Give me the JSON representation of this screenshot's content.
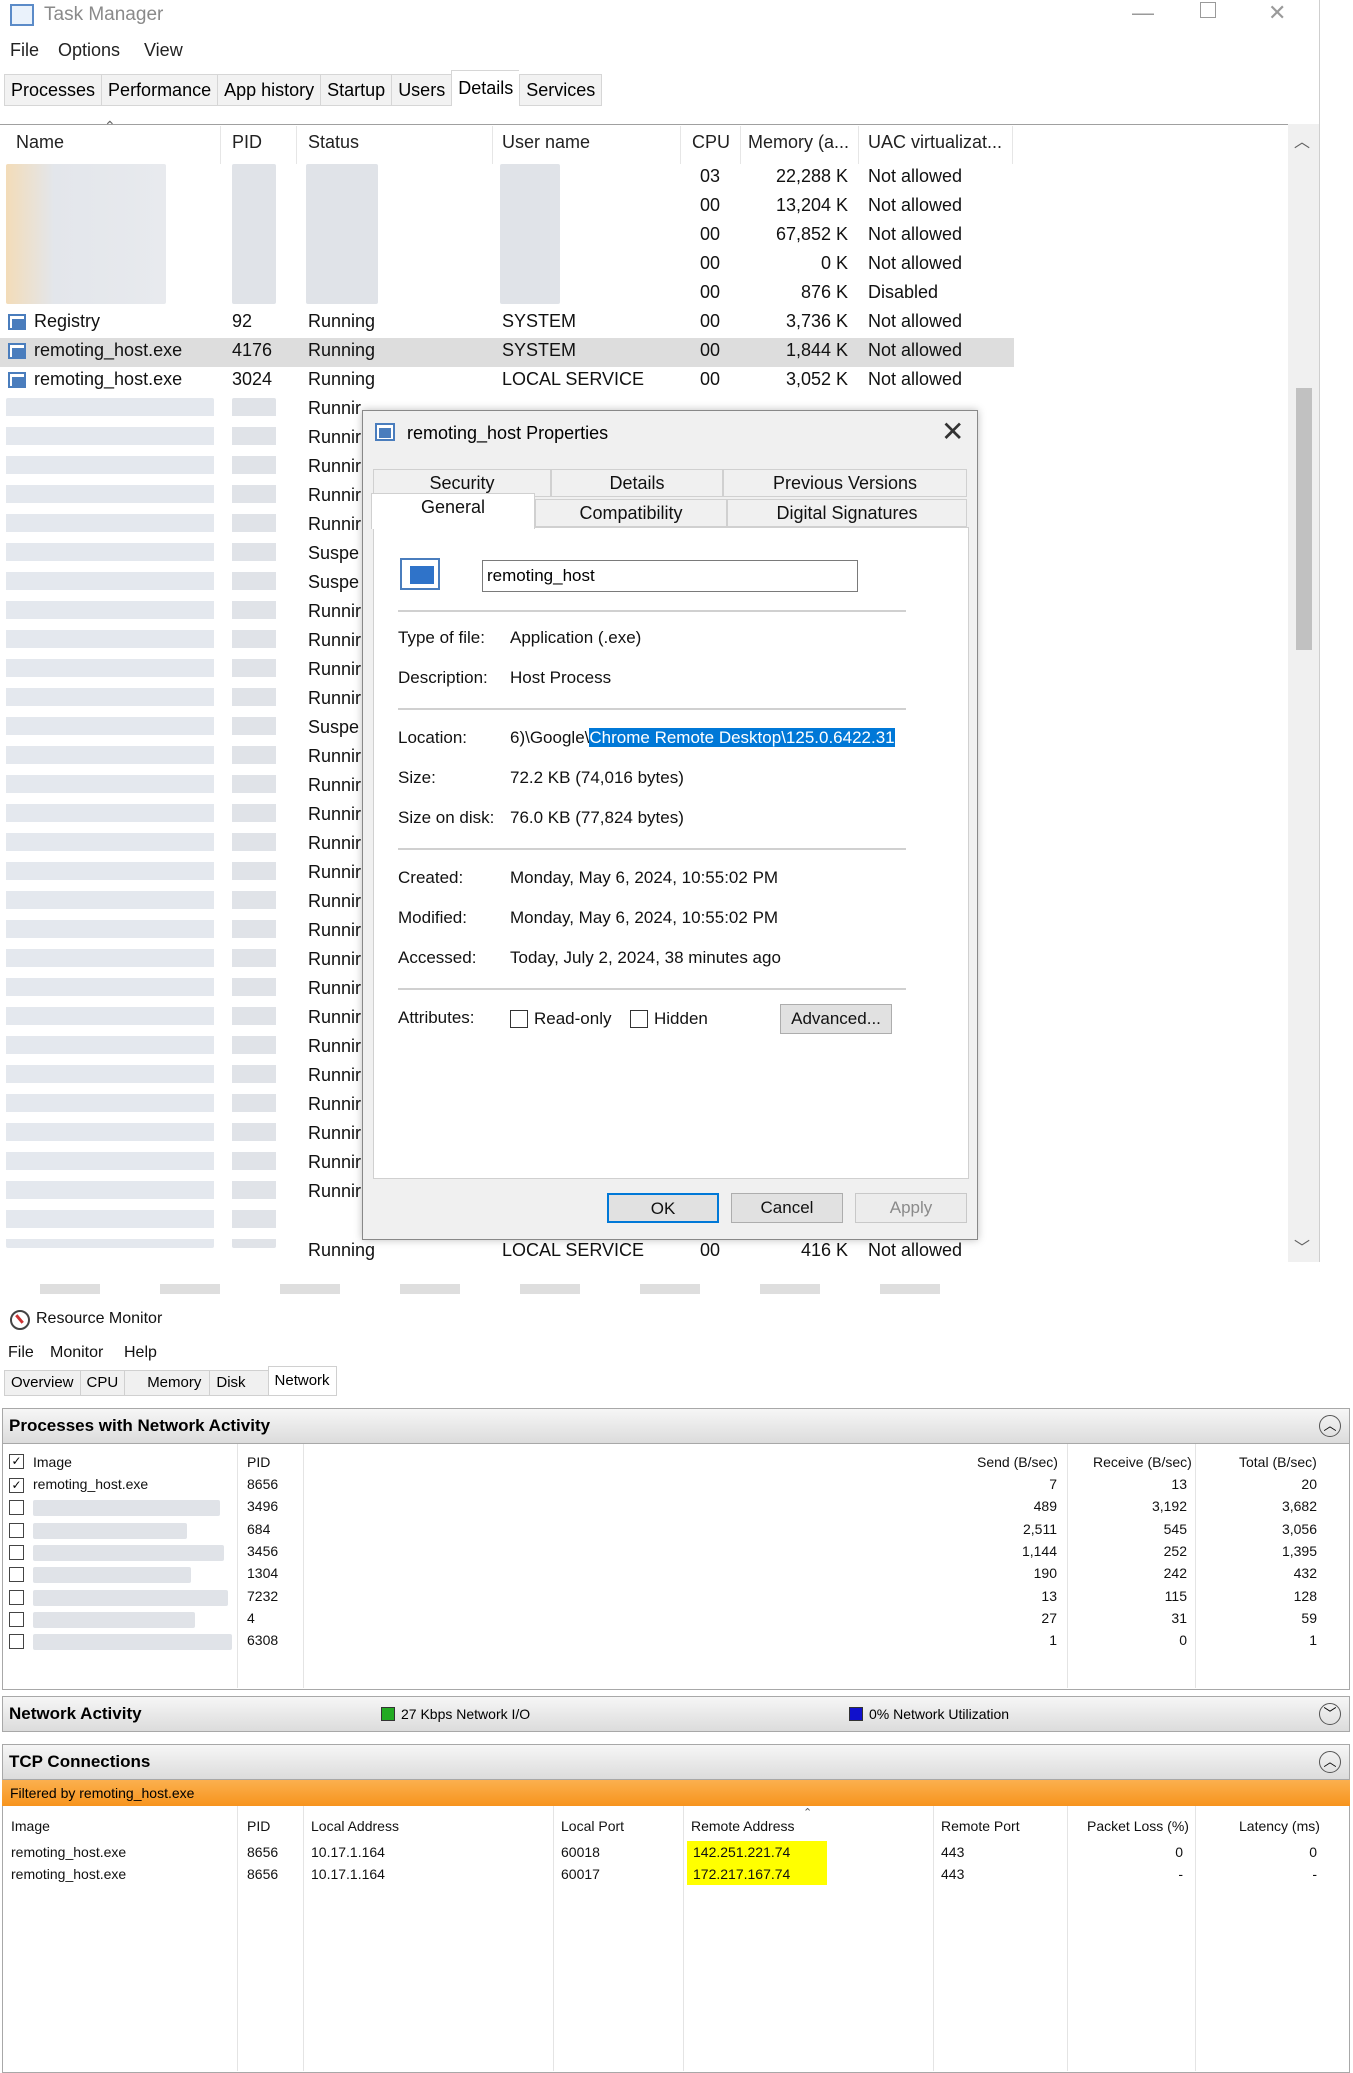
{
  "task_manager": {
    "title": "Task Manager",
    "menu": [
      "File",
      "Options",
      "View"
    ],
    "tabs": [
      "Processes",
      "Performance",
      "App history",
      "Startup",
      "Users",
      "Details",
      "Services"
    ],
    "selected_tab": "Details",
    "columns": [
      "Name",
      "PID",
      "Status",
      "User name",
      "CPU",
      "Memory (a...",
      "UAC virtualizat..."
    ],
    "blurred_rows": [
      {
        "cpu": "03",
        "memory": "22,288 K",
        "uac": "Not allowed"
      },
      {
        "cpu": "00",
        "memory": "13,204 K",
        "uac": "Not allowed"
      },
      {
        "cpu": "00",
        "memory": "67,852 K",
        "uac": "Not allowed"
      },
      {
        "cpu": "00",
        "memory": "0 K",
        "uac": "Not allowed"
      },
      {
        "cpu": "00",
        "memory": "876 K",
        "uac": "Disabled"
      }
    ],
    "rows": [
      {
        "name": "Registry",
        "pid": "92",
        "status": "Running",
        "user": "SYSTEM",
        "cpu": "00",
        "memory": "3,736 K",
        "uac": "Not allowed"
      },
      {
        "name": "remoting_host.exe",
        "pid": "4176",
        "status": "Running",
        "user": "SYSTEM",
        "cpu": "00",
        "memory": "1,844 K",
        "uac": "Not allowed"
      },
      {
        "name": "remoting_host.exe",
        "pid": "3024",
        "status": "Running",
        "user": "LOCAL SERVICE",
        "cpu": "00",
        "memory": "3,052 K",
        "uac": "Not allowed"
      }
    ],
    "partial_statuses": [
      "Runnir",
      "Runnir",
      "Runnir",
      "Runnir",
      "Runnir",
      "Suspe",
      "Suspe",
      "Runnir",
      "Runnir",
      "Runnir",
      "Runnir",
      "Suspe",
      "Runnir",
      "Runnir",
      "Runnir",
      "Runnir",
      "Runnir",
      "Runnir",
      "Runnir",
      "Runnir",
      "Runnir",
      "Runnir",
      "Runnir",
      "Runnir",
      "Runnir",
      "Runnir",
      "Runnir",
      "Runnir"
    ],
    "bottom_row": {
      "status": "Running",
      "user": "LOCAL SERVICE",
      "cpu": "00",
      "memory": "416 K",
      "uac": "Not allowed"
    }
  },
  "properties_dialog": {
    "title": "remoting_host Properties",
    "tabs_top": [
      "Security",
      "Details",
      "Previous Versions"
    ],
    "tabs_bottom": [
      "General",
      "Compatibility",
      "Digital Signatures"
    ],
    "selected_tab": "General",
    "file_name": "remoting_host",
    "type_label": "Type of file:",
    "type_value": "Application (.exe)",
    "desc_label": "Description:",
    "desc_value": "Host Process",
    "location_label": "Location:",
    "location_prefix": "6)\\Google\\",
    "location_highlight": "Chrome Remote Desktop\\125.0.6422.31",
    "size_label": "Size:",
    "size_value": "72.2 KB (74,016 bytes)",
    "size_disk_label": "Size on disk:",
    "size_disk_value": "76.0 KB (77,824 bytes)",
    "created_label": "Created:",
    "created_value": "Monday, May 6, 2024, 10:55:02 PM",
    "modified_label": "Modified:",
    "modified_value": "Monday, May 6, 2024, 10:55:02 PM",
    "accessed_label": "Accessed:",
    "accessed_value": "Today, July 2, 2024, 38 minutes ago",
    "attributes_label": "Attributes:",
    "readonly_label": "Read-only",
    "hidden_label": "Hidden",
    "advanced_label": "Advanced...",
    "ok_label": "OK",
    "cancel_label": "Cancel",
    "apply_label": "Apply"
  },
  "resource_monitor": {
    "title": "Resource Monitor",
    "menu": [
      "File",
      "Monitor",
      "Help"
    ],
    "tabs": [
      "Overview",
      "CPU",
      "Memory",
      "Disk",
      "Network"
    ],
    "selected_tab": "Network",
    "processes_section": "Processes with Network Activity",
    "proc_columns": [
      "Image",
      "PID",
      "Send (B/sec)",
      "Receive (B/sec)",
      "Total (B/sec)"
    ],
    "processes": [
      {
        "image": "remoting_host.exe",
        "pid": "8656",
        "send": "7",
        "receive": "13",
        "total": "20",
        "checked": true
      },
      {
        "image": "",
        "pid": "3496",
        "send": "489",
        "receive": "3,192",
        "total": "3,682",
        "checked": false
      },
      {
        "image": "",
        "pid": "684",
        "send": "2,511",
        "receive": "545",
        "total": "3,056",
        "checked": false
      },
      {
        "image": "",
        "pid": "3456",
        "send": "1,144",
        "receive": "252",
        "total": "1,395",
        "checked": false
      },
      {
        "image": "",
        "pid": "1304",
        "send": "190",
        "receive": "242",
        "total": "432",
        "checked": false
      },
      {
        "image": "",
        "pid": "7232",
        "send": "13",
        "receive": "115",
        "total": "128",
        "checked": false
      },
      {
        "image": "",
        "pid": "4",
        "send": "27",
        "receive": "31",
        "total": "59",
        "checked": false
      },
      {
        "image": "",
        "pid": "6308",
        "send": "1",
        "receive": "0",
        "total": "1",
        "checked": false
      }
    ],
    "network_activity_section": "Network Activity",
    "network_io": "27 Kbps Network I/O",
    "network_util": "0% Network Utilization",
    "tcp_section": "TCP Connections",
    "filter_text": "Filtered by remoting_host.exe",
    "tcp_columns": [
      "Image",
      "PID",
      "Local Address",
      "Local Port",
      "Remote Address",
      "Remote Port",
      "Packet Loss (%)",
      "Latency (ms)"
    ],
    "tcp_rows": [
      {
        "image": "remoting_host.exe",
        "pid": "8656",
        "local_addr": "10.17.1.164",
        "local_port": "60018",
        "remote_addr": "142.251.221.74",
        "remote_port": "443",
        "loss": "0",
        "latency": "0"
      },
      {
        "image": "remoting_host.exe",
        "pid": "8656",
        "local_addr": "10.17.1.164",
        "local_port": "60017",
        "remote_addr": "172.217.167.74",
        "remote_port": "443",
        "loss": "-",
        "latency": "-"
      }
    ],
    "colors": {
      "io_green": "#22aa22",
      "util_blue": "#1010cc",
      "filter_orange": "#f7941d",
      "highlight_yellow": "#ffff00"
    }
  }
}
